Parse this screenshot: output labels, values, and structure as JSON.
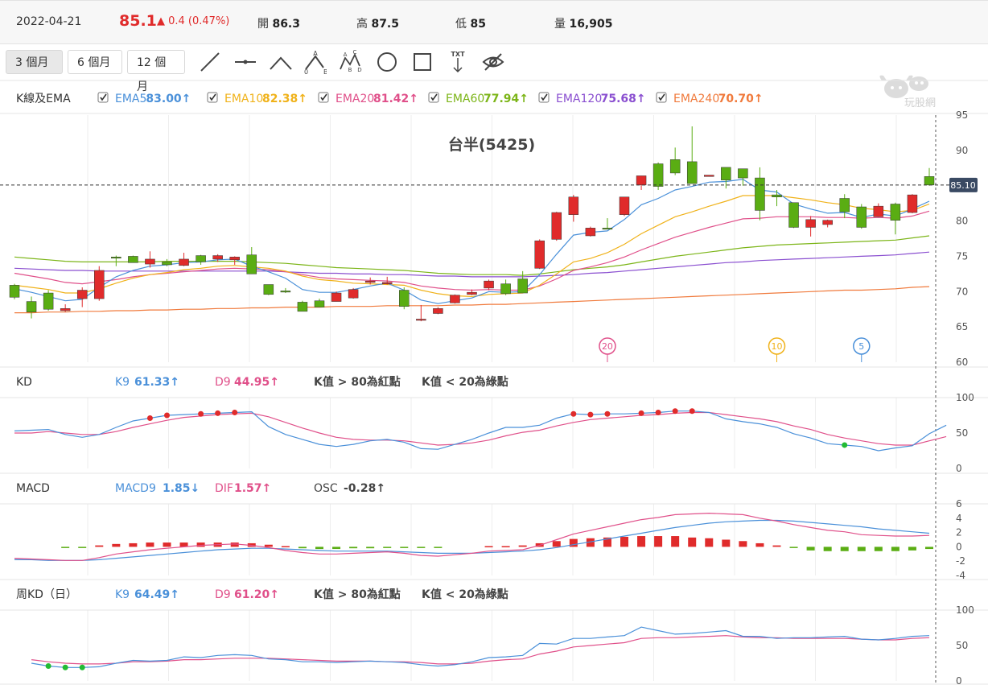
{
  "quote": {
    "date": "2022-04-21",
    "price": "85.1",
    "change": "▲ 0.4 (0.47%)",
    "open_label": "開",
    "open": "86.3",
    "high_label": "高",
    "high": "87.5",
    "low_label": "低",
    "low": "85",
    "vol_label": "量",
    "vol": "16,905"
  },
  "periods": [
    "3 個月",
    "6 個月",
    "12 個月"
  ],
  "tools": [
    "line-tool-icon",
    "horizontal-line-tool-icon",
    "angle-tool-icon",
    "abc-pattern-tool-icon",
    "abcd-pattern-tool-icon",
    "circle-tool-icon",
    "rectangle-tool-icon",
    "text-tool-icon",
    "hide-eye-icon"
  ],
  "tool_labels": {
    "txt": "TXT",
    "a": "A",
    "b": "B",
    "c": "C",
    "d": "D",
    "o": "0"
  },
  "watermark": "玩股網",
  "colors": {
    "up": "#e02b2b",
    "down": "#5aad13",
    "ema5": "#4a90d9",
    "ema10": "#f0b21a",
    "ema20": "#e0508a",
    "ema60": "#7cb518",
    "ema120": "#8a4fd0",
    "ema240": "#f07a3c",
    "k": "#4a90d9",
    "d": "#e0508a"
  },
  "ema_panel": {
    "title": "K線及EMA",
    "items": [
      {
        "name": "EMA5",
        "value": "83.00↑",
        "color": "#4a90d9"
      },
      {
        "name": "EMA10",
        "value": "82.38↑",
        "color": "#f0b21a"
      },
      {
        "name": "EMA20",
        "value": "81.42↑",
        "color": "#e0508a"
      },
      {
        "name": "EMA60",
        "value": "77.94↑",
        "color": "#7cb518"
      },
      {
        "name": "EMA120",
        "value": "75.68↑",
        "color": "#8a4fd0"
      },
      {
        "name": "EMA240",
        "value": "70.70↑",
        "color": "#f07a3c"
      }
    ]
  },
  "kd_panel": {
    "title": "KD",
    "k_label": "K9",
    "k_value": "61.33↑",
    "d_label": "D9",
    "d_value": "44.95↑",
    "note1": "K值 > 80為紅點",
    "note2": "K值 < 20為綠點"
  },
  "macd_panel": {
    "title": "MACD",
    "macd_label": "MACD9",
    "macd_value": "1.85↓",
    "dif_label": "DIF",
    "dif_value": "1.57↑",
    "osc_label": "OSC",
    "osc_value": "-0.28↑"
  },
  "wkd_panel": {
    "title": "周KD（日）",
    "k_label": "K9",
    "k_value": "64.49↑",
    "d_label": "D9",
    "d_value": "61.20↑",
    "note1": "K值 > 80為紅點",
    "note2": "K值 < 20為綠點"
  },
  "chart_data": {
    "type": "candlestick",
    "title": "台半(5425)",
    "last_price_label": "85.10",
    "last_price": 85.1,
    "price_ticks": [
      60,
      65,
      70,
      75,
      80,
      85,
      90,
      95
    ],
    "kd_ticks": [
      0,
      50,
      100
    ],
    "macd_ticks": [
      -4,
      -2,
      0,
      2,
      4,
      6
    ],
    "markers": [
      {
        "label": "20",
        "index": 35,
        "color": "#e0508a"
      },
      {
        "label": "10",
        "index": 45,
        "color": "#f0b21a"
      },
      {
        "label": "5",
        "index": 50,
        "color": "#4a90d9"
      }
    ],
    "candles": [
      [
        70.9,
        69.2,
        71.1,
        68.9
      ],
      [
        68.6,
        67.1,
        69.3,
        66.2
      ],
      [
        69.8,
        67.5,
        70.2,
        67.3
      ],
      [
        67.3,
        67.6,
        68.2,
        67.1
      ],
      [
        69,
        70.2,
        70.6,
        67.8
      ],
      [
        69,
        73,
        73.6,
        68.7
      ],
      [
        74.9,
        74.8,
        75.1,
        73.6
      ],
      [
        75,
        74.1,
        75.1,
        74.1
      ],
      [
        73.9,
        74.6,
        75.7,
        73.4
      ],
      [
        74.2,
        73.8,
        74.6,
        73.6
      ],
      [
        73.7,
        74.6,
        75.5,
        73.6
      ],
      [
        75.1,
        74.2,
        75.2,
        73.8
      ],
      [
        74.6,
        75.1,
        75.3,
        74.2
      ],
      [
        74.5,
        74.9,
        75,
        73.8
      ],
      [
        75.2,
        72.5,
        76.3,
        72.5
      ],
      [
        71,
        69.6,
        70.8,
        69.5
      ],
      [
        70.1,
        70.1,
        70.5,
        69.8
      ],
      [
        68.5,
        67.2,
        68.7,
        67.2
      ],
      [
        68.7,
        67.8,
        69,
        68
      ],
      [
        68.6,
        69.8,
        70,
        68.6
      ],
      [
        69.1,
        70.3,
        70.5,
        69
      ],
      [
        71.3,
        71.5,
        72,
        71
      ],
      [
        71.1,
        71.3,
        72.1,
        71
      ],
      [
        70.2,
        67.9,
        70.6,
        67.5
      ],
      [
        66,
        66.1,
        68.1,
        65.8
      ],
      [
        66.9,
        67.6,
        67.8,
        66.8
      ],
      [
        68.4,
        69.5,
        69.6,
        68.3
      ],
      [
        69.6,
        69.9,
        70.3,
        69.5
      ],
      [
        70.5,
        71.5,
        71.7,
        70.2
      ],
      [
        71.1,
        69.7,
        71.7,
        69.5
      ],
      [
        71.8,
        69.8,
        72.9,
        69.9
      ],
      [
        73.3,
        77.2,
        77.4,
        73.2
      ],
      [
        77.4,
        81.2,
        81.3,
        77.2
      ],
      [
        80.9,
        83.4,
        83.7,
        79.9
      ],
      [
        77.9,
        79,
        79.2,
        77.8
      ],
      [
        79,
        79,
        80.4,
        79
      ],
      [
        80.9,
        83.4,
        83.3,
        80.7
      ],
      [
        85.1,
        86.4,
        86.4,
        84.4
      ],
      [
        88.1,
        84.9,
        88.3,
        84.4
      ],
      [
        88.7,
        86.8,
        90.4,
        86.5
      ],
      [
        88.4,
        85.3,
        93.4,
        85.5
      ],
      [
        86.3,
        86.5,
        86.4,
        86.3
      ],
      [
        87.6,
        85.8,
        87.5,
        84.6
      ],
      [
        87.4,
        86.1,
        87.2,
        85
      ],
      [
        86.1,
        81.5,
        87.6,
        80.1
      ],
      [
        83.7,
        83.4,
        84.4,
        82.1
      ],
      [
        82.6,
        79.1,
        82.6,
        79
      ],
      [
        79.1,
        80.2,
        80.7,
        77.8
      ],
      [
        79.5,
        80.1,
        80.2,
        79.1
      ],
      [
        83.2,
        81.3,
        83.8,
        80.4
      ],
      [
        82,
        79.1,
        82.4,
        78.9
      ],
      [
        80.6,
        82.1,
        82.5,
        80.6
      ],
      [
        82.4,
        80.1,
        82.6,
        78.1
      ],
      [
        81.2,
        83.7,
        83.8,
        81.1
      ],
      [
        86.3,
        85.1,
        87.5,
        85
      ]
    ],
    "series": [
      {
        "name": "EMA5",
        "color": "#4a90d9",
        "values": [
          70.4,
          69.9,
          69.3,
          68.7,
          68.9,
          70.6,
          72.1,
          73,
          73.6,
          73.8,
          74.1,
          74.2,
          74.5,
          74.6,
          73.6,
          72.8,
          71.9,
          70.3,
          69.9,
          69.9,
          70.3,
          70.8,
          71.2,
          70.2,
          68.8,
          68.3,
          68.7,
          69.1,
          70,
          69.9,
          70,
          72.4,
          75.3,
          78,
          78.4,
          78.6,
          80.2,
          82.3,
          83.2,
          84.4,
          84.9,
          85.5,
          85.6,
          85.9,
          84.4,
          84.1,
          82.4,
          81.7,
          81.1,
          81.2,
          80.5,
          81,
          80.7,
          81.7,
          82.8
        ]
      },
      {
        "name": "EMA10",
        "color": "#f0b21a",
        "values": [
          70.9,
          70.6,
          70.3,
          69.8,
          69.8,
          70.4,
          71.2,
          71.9,
          72.4,
          72.7,
          73.1,
          73.3,
          73.6,
          73.7,
          73.5,
          73.3,
          72.9,
          72.2,
          71.7,
          71.5,
          71.2,
          71.1,
          71,
          70.9,
          70.2,
          69.7,
          69.4,
          69.3,
          69.6,
          69.7,
          69.8,
          70.9,
          72.5,
          74.2,
          74.7,
          75.5,
          76.7,
          78.2,
          79.4,
          80.6,
          81.3,
          82.1,
          82.8,
          83.6,
          83.6,
          83.6,
          83.3,
          83,
          82.6,
          82.3,
          81.8,
          81.6,
          81.3,
          81.5,
          82.4
        ]
      },
      {
        "name": "EMA20",
        "color": "#e0508a",
        "values": [
          72.6,
          72.2,
          71.8,
          71.3,
          71.1,
          71.4,
          71.7,
          72.1,
          72.4,
          72.6,
          72.8,
          73,
          73.2,
          73.3,
          73.2,
          73.1,
          72.8,
          72.4,
          72,
          71.8,
          71.7,
          71.6,
          71.5,
          71.3,
          70.8,
          70.5,
          70.3,
          70.2,
          70.3,
          70.2,
          70.2,
          70.8,
          71.8,
          73,
          73.5,
          74.1,
          74.9,
          75.9,
          76.8,
          77.7,
          78.4,
          79.1,
          79.7,
          80.3,
          80.4,
          80.6,
          80.6,
          80.6,
          80.5,
          80.5,
          80.4,
          80.5,
          80.4,
          80.7,
          81.4
        ]
      },
      {
        "name": "EMA60",
        "color": "#7cb518",
        "values": [
          74.9,
          74.7,
          74.5,
          74.3,
          74.2,
          74.2,
          74.2,
          74.2,
          74.2,
          74.3,
          74.3,
          74.3,
          74.3,
          74.3,
          74.2,
          74.1,
          74,
          73.8,
          73.6,
          73.4,
          73.3,
          73.2,
          73.1,
          73,
          72.8,
          72.6,
          72.5,
          72.4,
          72.4,
          72.4,
          72.3,
          72.5,
          72.8,
          73.1,
          73.3,
          73.5,
          73.8,
          74.2,
          74.6,
          75,
          75.3,
          75.6,
          75.9,
          76.2,
          76.4,
          76.6,
          76.7,
          76.8,
          76.9,
          77,
          77.1,
          77.2,
          77.3,
          77.6,
          77.9
        ]
      },
      {
        "name": "EMA120",
        "color": "#8a4fd0",
        "values": [
          73.3,
          73.2,
          73.1,
          73,
          73,
          72.9,
          72.9,
          72.9,
          72.9,
          72.9,
          72.9,
          72.9,
          72.9,
          72.9,
          72.9,
          72.9,
          72.8,
          72.7,
          72.6,
          72.6,
          72.5,
          72.5,
          72.4,
          72.4,
          72.3,
          72.2,
          72.2,
          72.1,
          72.1,
          72.1,
          72.1,
          72.2,
          72.3,
          72.4,
          72.6,
          72.7,
          72.9,
          73.1,
          73.3,
          73.5,
          73.7,
          73.9,
          74.1,
          74.2,
          74.4,
          74.5,
          74.6,
          74.7,
          74.8,
          74.9,
          75,
          75.1,
          75.2,
          75.4,
          75.6
        ]
      },
      {
        "name": "EMA240",
        "color": "#f07a3c",
        "values": [
          67,
          67,
          67.1,
          67.1,
          67.2,
          67.2,
          67.3,
          67.3,
          67.4,
          67.4,
          67.5,
          67.5,
          67.6,
          67.6,
          67.7,
          67.7,
          67.8,
          67.8,
          67.8,
          67.9,
          67.9,
          67.9,
          68,
          68,
          68,
          68,
          68.1,
          68.1,
          68.2,
          68.2,
          68.3,
          68.4,
          68.5,
          68.6,
          68.7,
          68.8,
          68.9,
          69,
          69.1,
          69.2,
          69.3,
          69.4,
          69.5,
          69.6,
          69.7,
          69.8,
          69.9,
          70,
          70.1,
          70.2,
          70.2,
          70.3,
          70.4,
          70.6,
          70.7
        ]
      }
    ],
    "kd_k": [
      53,
      54,
      55,
      48,
      44,
      48,
      58,
      67,
      71,
      75,
      76,
      77,
      78,
      79,
      80,
      59,
      48,
      41,
      34,
      31,
      34,
      39,
      41,
      37,
      28,
      27,
      34,
      41,
      50,
      58,
      58,
      61,
      71,
      77,
      76,
      77,
      77,
      78,
      79,
      81,
      81,
      79,
      70,
      66,
      63,
      58,
      49,
      43,
      35,
      33,
      31,
      25,
      29,
      32,
      49,
      61
    ],
    "kd_d": [
      50,
      50,
      52,
      50,
      48,
      48,
      52,
      58,
      63,
      68,
      72,
      74,
      76,
      77,
      78,
      73,
      65,
      57,
      50,
      44,
      41,
      40,
      40,
      39,
      36,
      33,
      34,
      36,
      40,
      46,
      51,
      54,
      60,
      65,
      69,
      71,
      73,
      75,
      76,
      78,
      79,
      79,
      76,
      73,
      70,
      66,
      60,
      55,
      48,
      43,
      39,
      35,
      33,
      33,
      39,
      45
    ],
    "kd_red_dots": [
      8,
      9,
      11,
      12,
      13,
      33,
      34,
      35,
      37,
      38,
      39,
      40
    ],
    "kd_green_dots": [
      49
    ],
    "dif": [
      -1.6,
      -1.7,
      -1.8,
      -1.9,
      -1.9,
      -1.5,
      -1,
      -0.7,
      -0.4,
      -0.2,
      0,
      0.2,
      0.3,
      0.4,
      0.2,
      -0.1,
      -0.5,
      -0.8,
      -1,
      -1,
      -0.9,
      -0.8,
      -0.7,
      -0.9,
      -1.2,
      -1.3,
      -1.1,
      -0.9,
      -0.6,
      -0.5,
      -0.4,
      0.2,
      1,
      1.8,
      2.3,
      2.8,
      3.3,
      3.8,
      4.1,
      4.5,
      4.6,
      4.7,
      4.6,
      4.5,
      4,
      3.6,
      3.1,
      2.7,
      2.3,
      2.1,
      1.7,
      1.6,
      1.5,
      1.5,
      1.6
    ],
    "macd": [
      -1.8,
      -1.8,
      -1.9,
      -1.9,
      -1.9,
      -1.8,
      -1.6,
      -1.4,
      -1.2,
      -1,
      -0.8,
      -0.6,
      -0.4,
      -0.3,
      -0.2,
      -0.2,
      -0.3,
      -0.4,
      -0.5,
      -0.6,
      -0.6,
      -0.6,
      -0.6,
      -0.7,
      -0.8,
      -0.9,
      -0.9,
      -0.9,
      -0.8,
      -0.7,
      -0.6,
      -0.4,
      -0.1,
      0.3,
      0.7,
      1.1,
      1.5,
      1.9,
      2.3,
      2.7,
      3,
      3.3,
      3.5,
      3.6,
      3.7,
      3.7,
      3.6,
      3.4,
      3.2,
      3,
      2.8,
      2.5,
      2.3,
      2.1,
      1.9
    ],
    "osc": [
      0,
      0,
      0,
      -0.1,
      -0.1,
      0.2,
      0.4,
      0.5,
      0.6,
      0.6,
      0.6,
      0.6,
      0.6,
      0.6,
      0.5,
      0.3,
      0.1,
      -0.2,
      -0.3,
      -0.3,
      -0.2,
      -0.2,
      -0.1,
      -0.1,
      -0.1,
      -0.1,
      0,
      0,
      0.1,
      0.1,
      0.2,
      0.5,
      0.8,
      1.1,
      1.2,
      1.3,
      1.4,
      1.5,
      1.5,
      1.5,
      1.3,
      1.2,
      1,
      0.8,
      0.5,
      0.2,
      -0.1,
      -0.5,
      -0.6,
      -0.6,
      -0.6,
      -0.6,
      -0.6,
      -0.5,
      -0.3
    ],
    "wkd_k": [
      25,
      21,
      19,
      19,
      20,
      25,
      29,
      28,
      29,
      34,
      33,
      36,
      37,
      36,
      31,
      30,
      27,
      27,
      26,
      27,
      28,
      27,
      26,
      23,
      21,
      23,
      27,
      33,
      34,
      36,
      53,
      52,
      60,
      60,
      62,
      64,
      76,
      71,
      66,
      67,
      69,
      71,
      63,
      63,
      60,
      61,
      61,
      62,
      63,
      59,
      58,
      60,
      63,
      64
    ],
    "wkd_d": [
      30,
      27,
      25,
      24,
      24,
      25,
      27,
      27,
      28,
      30,
      30,
      31,
      32,
      32,
      32,
      31,
      30,
      29,
      28,
      28,
      28,
      27,
      27,
      26,
      24,
      24,
      25,
      28,
      30,
      31,
      38,
      42,
      48,
      50,
      52,
      54,
      60,
      61,
      61,
      62,
      63,
      64,
      62,
      61,
      61,
      60,
      60,
      60,
      60,
      59,
      58,
      58,
      60,
      61
    ],
    "wkd_green_dots": [
      1,
      2,
      3
    ]
  }
}
